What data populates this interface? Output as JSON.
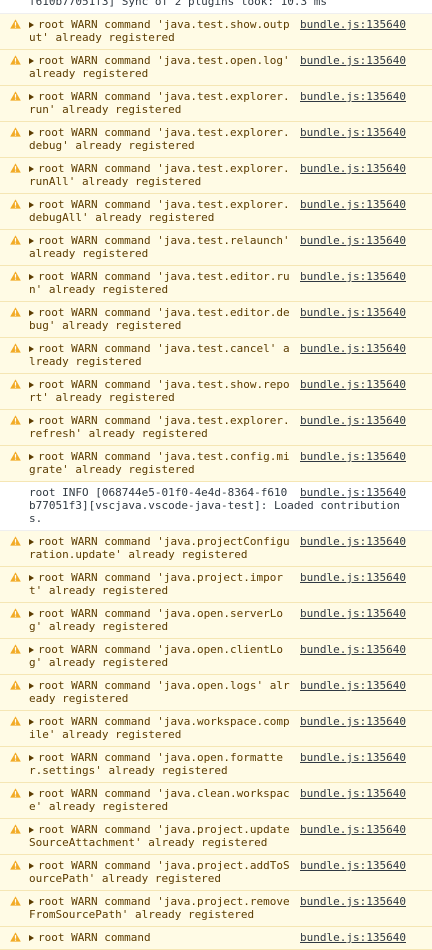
{
  "colors": {
    "warn_bg": "#fffbe5",
    "warn_text": "#5c3c00",
    "warn_border": "#f5e6b4",
    "warn_icon": "#f2ab26"
  },
  "partial_top": {
    "text": "f610b77051f3] Sync of 2 plugins took: 10.3 ms"
  },
  "rows": [
    {
      "level": "warn",
      "source": "bundle.js:135640",
      "text": "root WARN command 'java.test.show.output' already registered"
    },
    {
      "level": "warn",
      "source": "bundle.js:135640",
      "text": "root WARN command 'java.test.open.log' already registered"
    },
    {
      "level": "warn",
      "source": "bundle.js:135640",
      "text": "root WARN command 'java.test.explorer.run' already registered"
    },
    {
      "level": "warn",
      "source": "bundle.js:135640",
      "text": "root WARN command 'java.test.explorer.debug' already registered"
    },
    {
      "level": "warn",
      "source": "bundle.js:135640",
      "text": "root WARN command 'java.test.explorer.runAll' already registered"
    },
    {
      "level": "warn",
      "source": "bundle.js:135640",
      "text": "root WARN command 'java.test.explorer.debugAll' already registered"
    },
    {
      "level": "warn",
      "source": "bundle.js:135640",
      "text": "root WARN command 'java.test.relaunch' already registered"
    },
    {
      "level": "warn",
      "source": "bundle.js:135640",
      "text": "root WARN command 'java.test.editor.run' already registered"
    },
    {
      "level": "warn",
      "source": "bundle.js:135640",
      "text": "root WARN command 'java.test.editor.debug' already registered"
    },
    {
      "level": "warn",
      "source": "bundle.js:135640",
      "text": "root WARN command 'java.test.cancel' already registered"
    },
    {
      "level": "warn",
      "source": "bundle.js:135640",
      "text": "root WARN command 'java.test.show.report' already registered"
    },
    {
      "level": "warn",
      "source": "bundle.js:135640",
      "text": "root WARN command 'java.test.explorer.refresh' already registered"
    },
    {
      "level": "warn",
      "source": "bundle.js:135640",
      "text": "root WARN command 'java.test.config.migrate' already registered"
    },
    {
      "level": "info",
      "source": "bundle.js:135640",
      "text": "root INFO [068744e5-01f0-4e4d-8364-f610b77051f3][vscjava.vscode-java-test]: Loaded contributions."
    },
    {
      "level": "warn",
      "source": "bundle.js:135640",
      "text": "root WARN command 'java.projectConfiguration.update' already registered"
    },
    {
      "level": "warn",
      "source": "bundle.js:135640",
      "text": "root WARN command 'java.project.import' already registered"
    },
    {
      "level": "warn",
      "source": "bundle.js:135640",
      "text": "root WARN command 'java.open.serverLog' already registered"
    },
    {
      "level": "warn",
      "source": "bundle.js:135640",
      "text": "root WARN command 'java.open.clientLog' already registered"
    },
    {
      "level": "warn",
      "source": "bundle.js:135640",
      "text": "root WARN command 'java.open.logs' already registered"
    },
    {
      "level": "warn",
      "source": "bundle.js:135640",
      "text": "root WARN command 'java.workspace.compile' already registered"
    },
    {
      "level": "warn",
      "source": "bundle.js:135640",
      "text": "root WARN command 'java.open.formatter.settings' already registered"
    },
    {
      "level": "warn",
      "source": "bundle.js:135640",
      "text": "root WARN command 'java.clean.workspace' already registered"
    },
    {
      "level": "warn",
      "source": "bundle.js:135640",
      "text": "root WARN command 'java.project.updateSourceAttachment' already registered"
    },
    {
      "level": "warn",
      "source": "bundle.js:135640",
      "text": "root WARN command 'java.project.addToSourcePath' already registered"
    },
    {
      "level": "warn",
      "source": "bundle.js:135640",
      "text": "root WARN command 'java.project.removeFromSourcePath' already registered"
    },
    {
      "level": "warn",
      "source": "bundle.js:135640",
      "text": "root WARN command"
    }
  ]
}
